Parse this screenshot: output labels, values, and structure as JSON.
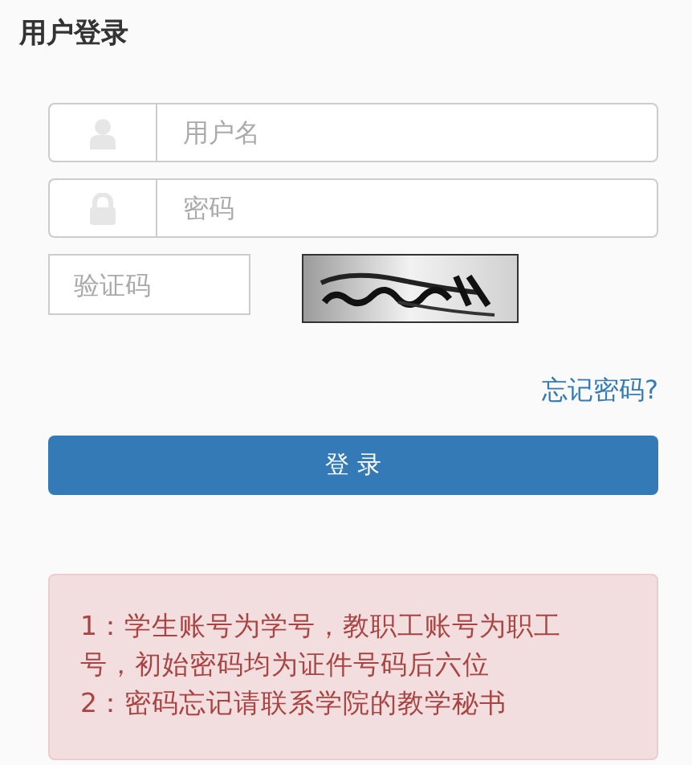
{
  "title": "用户登录",
  "fields": [
    {
      "kind": "user",
      "placeholder": "用户名"
    },
    {
      "kind": "password",
      "placeholder": "密码"
    }
  ],
  "captcha": {
    "placeholder": "验证码"
  },
  "forgot_link": "忘记密码?",
  "login_button": "登 录",
  "notes": [
    "1：学生账号为学号，教职工账号为职工号，初始密码均为证件号码后六位",
    "2：密码忘记请联系学院的教学秘书"
  ]
}
